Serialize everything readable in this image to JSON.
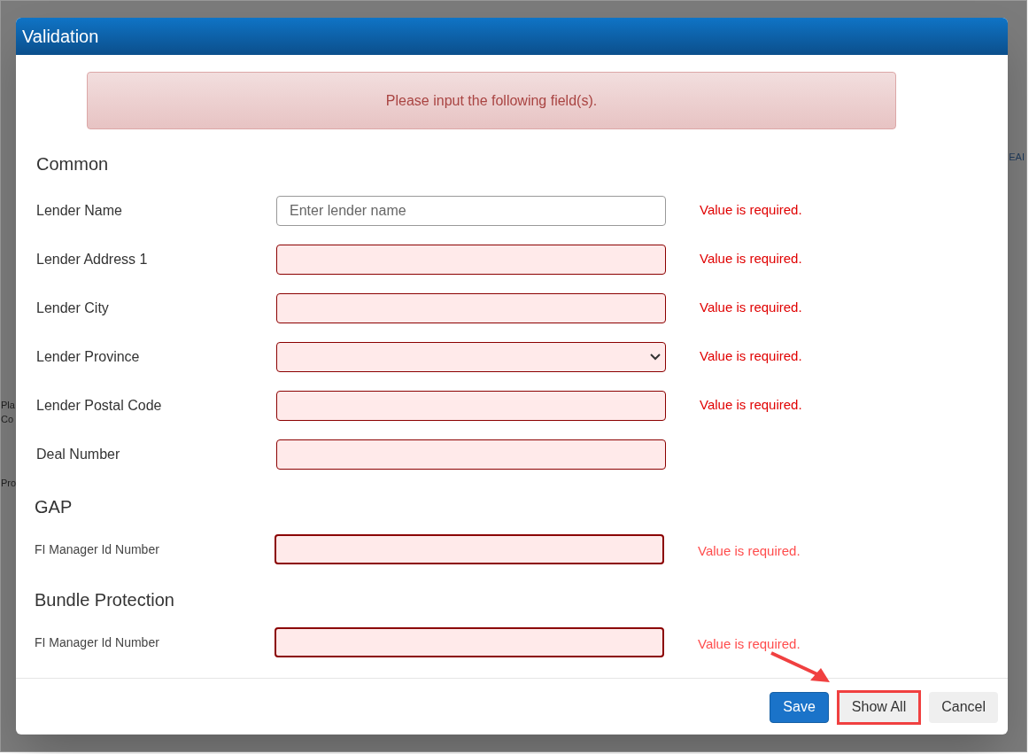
{
  "background": {
    "fragments_left": [
      "Pla",
      "Co",
      "Pro"
    ],
    "fragments_right": [
      "EAI"
    ]
  },
  "dialog": {
    "title": "Validation",
    "alert": "Please input the following field(s).",
    "sections": [
      {
        "heading": "Common",
        "fields": [
          {
            "label": "Lender Name",
            "kind": "text",
            "placeholder": "Enter lender name",
            "invalid": false,
            "error": "Value is required."
          },
          {
            "label": "Lender Address 1",
            "kind": "text",
            "invalid": true,
            "error": "Value is required."
          },
          {
            "label": "Lender City",
            "kind": "text",
            "invalid": true,
            "error": "Value is required."
          },
          {
            "label": "Lender Province",
            "kind": "select",
            "invalid": true,
            "error": "Value is required."
          },
          {
            "label": "Lender Postal Code",
            "kind": "text",
            "invalid": true,
            "error": "Value is required."
          },
          {
            "label": "Deal Number",
            "kind": "text",
            "invalid": true
          }
        ]
      },
      {
        "heading": "GAP",
        "fields": [
          {
            "label": "FI Manager Id Number",
            "kind": "text",
            "invalid": true,
            "error": "Value is required."
          }
        ]
      },
      {
        "heading": "Bundle Protection",
        "fields": [
          {
            "label": "FI Manager Id Number",
            "kind": "text",
            "invalid": true,
            "error": "Value is required."
          }
        ]
      }
    ],
    "buttons": [
      {
        "label": "Save",
        "kind": "primary",
        "highlighted": false
      },
      {
        "label": "Show All",
        "kind": "secondary",
        "highlighted": true
      },
      {
        "label": "Cancel",
        "kind": "secondary",
        "highlighted": false
      }
    ]
  }
}
